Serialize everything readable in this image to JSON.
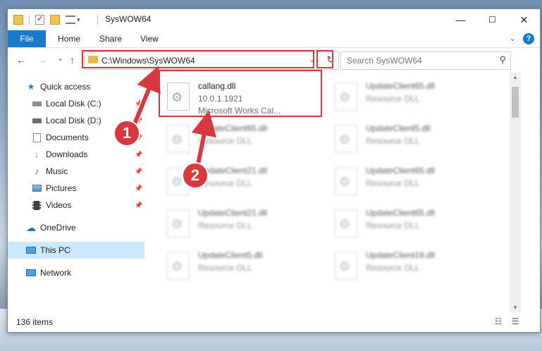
{
  "window": {
    "title": "SysWOW64",
    "controls": {
      "minimize": "—",
      "maximize": "☐",
      "close": "✕"
    }
  },
  "ribbon": {
    "file": "File",
    "tabs": [
      "Home",
      "Share",
      "View"
    ],
    "help": "?"
  },
  "navbar": {
    "back": "←",
    "forward": "→",
    "recent": "⌄",
    "up": "↑",
    "address": "C:\\Windows\\SysWOW64",
    "refresh": "↻",
    "search_placeholder": "Search SysWOW64"
  },
  "sidebar": {
    "items": [
      {
        "label": "Quick access",
        "icon": "star-icon"
      },
      {
        "label": "Local Disk (C:)",
        "icon": "drive-icon"
      },
      {
        "label": "Local Disk (D:)",
        "icon": "drive-icon"
      },
      {
        "label": "Documents",
        "icon": "documents-icon"
      },
      {
        "label": "Downloads",
        "icon": "download-icon"
      },
      {
        "label": "Music",
        "icon": "music-icon"
      },
      {
        "label": "Pictures",
        "icon": "pictures-icon"
      },
      {
        "label": "Videos",
        "icon": "videos-icon"
      },
      {
        "label": "OneDrive",
        "icon": "cloud-icon"
      },
      {
        "label": "This PC",
        "icon": "computer-icon"
      },
      {
        "label": "Network",
        "icon": "network-icon"
      }
    ]
  },
  "files": [
    {
      "name": "callang.dll",
      "line2": "10.0.1.1921",
      "line3": "Microsoft Works Cal..."
    },
    {
      "name": "UpdateClient65.dll",
      "line2": "Resource DLL"
    },
    {
      "name": "UpdateClient65.dll",
      "line2": "Resource DLL"
    },
    {
      "name": "UpdateClient5.dll",
      "line2": "Resource DLL"
    },
    {
      "name": "UpdateClient21.dll",
      "line2": "Resource DLL"
    },
    {
      "name": "UpdateClient65.dll",
      "line2": "Resource DLL"
    },
    {
      "name": "UpdateClient21.dll",
      "line2": "Resource DLL"
    },
    {
      "name": "UpdateClient65.dll",
      "line2": "Resource DLL"
    },
    {
      "name": "UpdateClient5.dll",
      "line2": "Resource DLL"
    },
    {
      "name": "UpdateClient19.dll",
      "line2": "Resource DLL"
    }
  ],
  "status": {
    "items": "136 items"
  },
  "annotations": {
    "step1": "1",
    "step2": "2"
  },
  "colors": {
    "accent": "#1979ca",
    "highlight": "#d9383f",
    "selected": "#cce8ff"
  }
}
